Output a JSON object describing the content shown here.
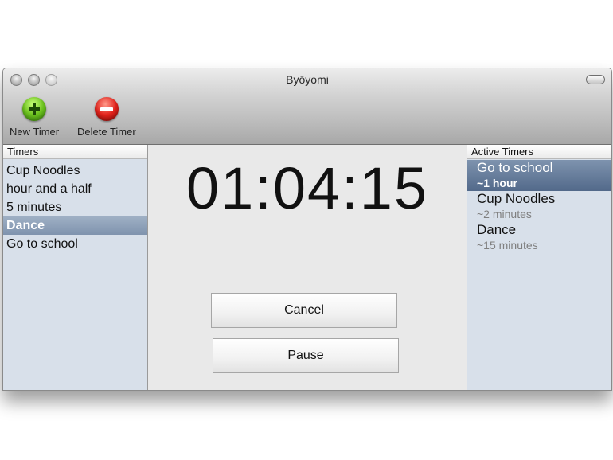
{
  "window": {
    "title": "Byōyomi"
  },
  "toolbar": {
    "new_timer_label": "New Timer",
    "delete_timer_label": "Delete Timer"
  },
  "timers_panel": {
    "header": "Timers",
    "items": [
      {
        "label": "Cup Noodles",
        "selected": false
      },
      {
        "label": "hour and a half",
        "selected": false
      },
      {
        "label": "5 minutes",
        "selected": false
      },
      {
        "label": "Dance",
        "selected": true
      },
      {
        "label": "Go to school",
        "selected": false
      }
    ]
  },
  "clock": {
    "time": "01:04:15"
  },
  "buttons": {
    "cancel_label": "Cancel",
    "pause_label": "Pause"
  },
  "active_panel": {
    "header": "Active Timers",
    "items": [
      {
        "name": "Go to school",
        "duration": "~1 hour",
        "selected": true
      },
      {
        "name": "Cup Noodles",
        "duration": "~2 minutes",
        "selected": false
      },
      {
        "name": "Dance",
        "duration": "~15 minutes",
        "selected": false
      }
    ]
  },
  "colors": {
    "selection_blue": "#7f93ae",
    "sidebar_bg": "#d8e0ea",
    "new_button_green": "#6cc21e",
    "delete_button_red": "#e2231c"
  },
  "icons": {
    "new_timer": "plus-circle-icon",
    "delete_timer": "minus-circle-icon"
  }
}
